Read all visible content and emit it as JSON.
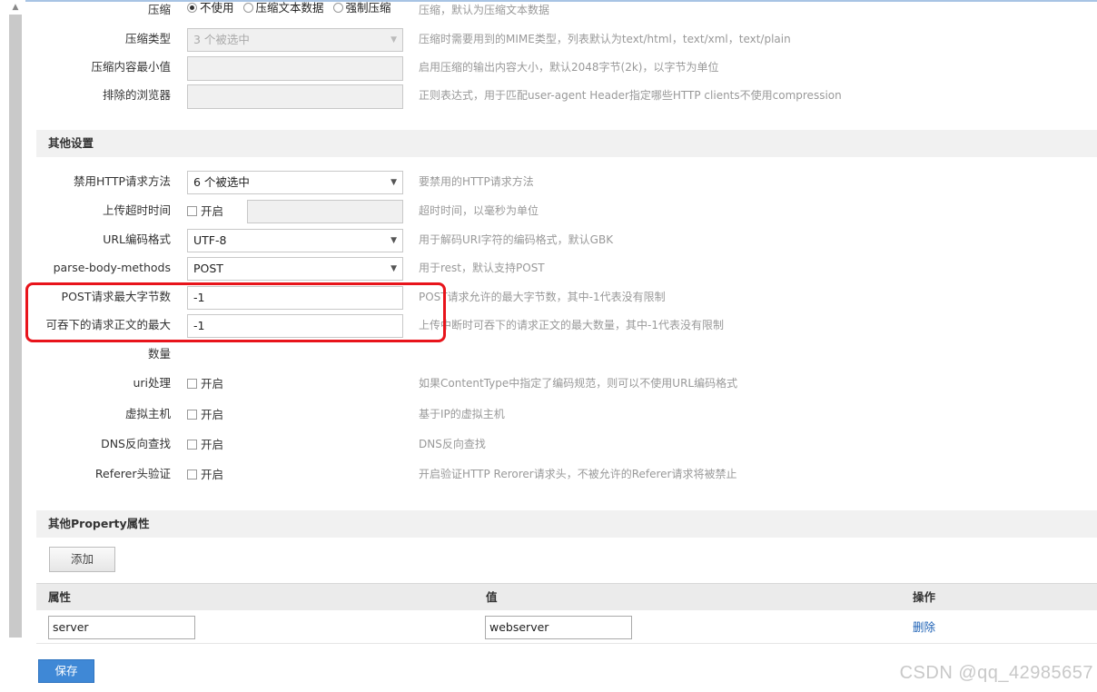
{
  "compression": {
    "label": "压缩",
    "options": [
      "不使用",
      "压缩文本数据",
      "强制压缩"
    ],
    "selected": "不使用",
    "hint": "压缩，默认为压缩文本数据"
  },
  "compression_type": {
    "label": "压缩类型",
    "value": "3 个被选中",
    "hint": "压缩时需要用到的MIME类型，列表默认为text/html，text/xml，text/plain"
  },
  "compression_min": {
    "label": "压缩内容最小值",
    "value": "",
    "hint": "启用压缩的输出内容大小，默认2048字节(2k)，以字节为单位"
  },
  "excluded_browsers": {
    "label": "排除的浏览器",
    "value": "",
    "hint": "正则表达式，用于匹配user-agent Header指定哪些HTTP clients不使用compression"
  },
  "other_settings": {
    "title": "其他设置",
    "disabled_http_methods": {
      "label": "禁用HTTP请求方法",
      "value": "6 个被选中",
      "hint": "要禁用的HTTP请求方法"
    },
    "upload_timeout": {
      "label": "上传超时时间",
      "checkbox": "开启",
      "value": "",
      "hint": "超时时间，以毫秒为单位"
    },
    "url_encoding": {
      "label": "URL编码格式",
      "value": "UTF-8",
      "hint": "用于解码URI字符的编码格式，默认GBK"
    },
    "parse_body_methods": {
      "label": "parse-body-methods",
      "value": "POST",
      "hint": "用于rest，默认支持POST"
    },
    "post_max_bytes": {
      "label": "POST请求最大字节数",
      "value": "-1",
      "hint": "POST请求允许的最大字节数，其中-1代表没有限制"
    },
    "swallow_max": {
      "label": "可吞下的请求正文的最大",
      "label_cont": "数量",
      "value": "-1",
      "hint": "上传中断时可吞下的请求正文的最大数量，其中-1代表没有限制"
    },
    "uri_handling": {
      "label": "uri处理",
      "checkbox": "开启",
      "hint": "如果ContentType中指定了编码规范，则可以不使用URL编码格式"
    },
    "virtual_host": {
      "label": "虚拟主机",
      "checkbox": "开启",
      "hint": "基于IP的虚拟主机"
    },
    "dns_lookup": {
      "label": "DNS反向查找",
      "checkbox": "开启",
      "hint": "DNS反向查找"
    },
    "referer_check": {
      "label": "Referer头验证",
      "checkbox": "开启",
      "hint": "开启验证HTTP Rerorer请求头，不被允许的Referer请求将被禁止"
    }
  },
  "property_section": {
    "title": "其他Property属性",
    "add_button": "添加",
    "columns": [
      "属性",
      "值",
      "操作"
    ],
    "rows": [
      {
        "property": "server",
        "value": "webserver",
        "action": "删除"
      }
    ]
  },
  "save_button": "保存",
  "watermark": "CSDN @qq_42985657"
}
